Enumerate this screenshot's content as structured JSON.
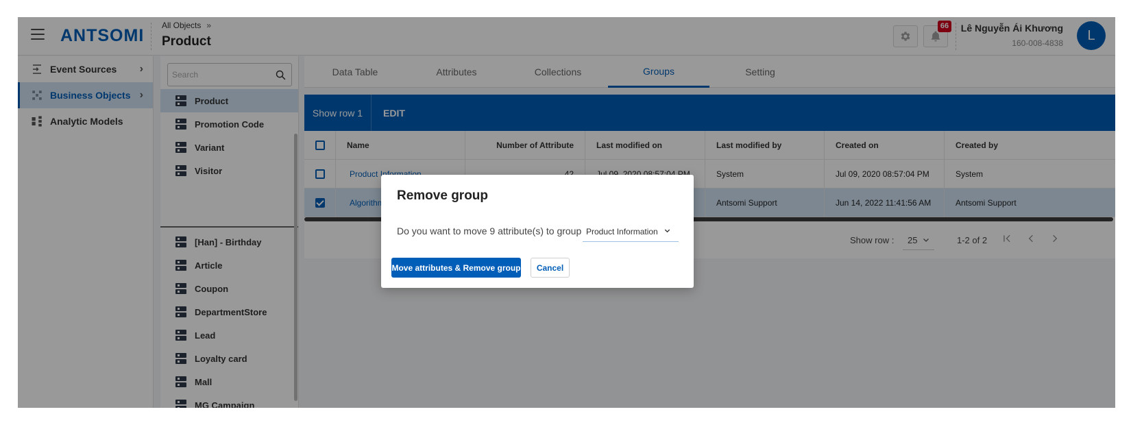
{
  "header": {
    "logo": "ANTSOMI",
    "breadcrumb": "All Objects",
    "breadcrumb_arrow": "»",
    "title": "Product",
    "notification_count": "66",
    "user_name": "Lê Nguyễn Ái Khương",
    "user_id": "160-008-4838",
    "avatar_initial": "L",
    "brand_color": "#005eb8"
  },
  "leftnav": {
    "items": [
      {
        "label": "Event Sources",
        "icon": "import-icon"
      },
      {
        "label": "Business Objects",
        "icon": "objects-icon"
      },
      {
        "label": "Analytic Models",
        "icon": "model-icon"
      }
    ]
  },
  "objects": {
    "search_placeholder": "Search",
    "items": [
      "Product",
      "Promotion Code",
      "Variant",
      "Visitor",
      "[Han] - Birthday",
      "Article",
      "Coupon",
      "DepartmentStore",
      "Lead",
      "Loyalty card",
      "Mall",
      "MG Campaign"
    ]
  },
  "tabs": [
    "Data Table",
    "Attributes",
    "Collections",
    "Groups",
    "Setting"
  ],
  "toolbar": {
    "show_row": "Show row 1",
    "edit": "EDIT"
  },
  "table": {
    "columns": [
      "Name",
      "Number of Attribute",
      "Last modified on",
      "Last modified by",
      "Created on",
      "Created by"
    ],
    "rows": [
      {
        "name": "Product Information",
        "count": "42",
        "modified_on": "Jul 09, 2020 08:57:04 PM",
        "modified_by": "System",
        "created_on": "Jul 09, 2020 08:57:04 PM",
        "created_by": "System",
        "checked": false
      },
      {
        "name": "Algorithms",
        "count": "",
        "modified_on": "",
        "modified_by": "Antsomi Support",
        "created_on": "Jun 14, 2022 11:41:56 AM",
        "created_by": "Antsomi Support",
        "checked": true
      }
    ]
  },
  "pager": {
    "label": "Show row :",
    "rows_value": "25",
    "range": "1-2 of 2"
  },
  "modal": {
    "title": "Remove group",
    "text": "Do you want to move 9 attribute(s) to group",
    "select_value": "Product Information",
    "primary_button": "Move attributes & Remove group",
    "cancel_button": "Cancel"
  }
}
